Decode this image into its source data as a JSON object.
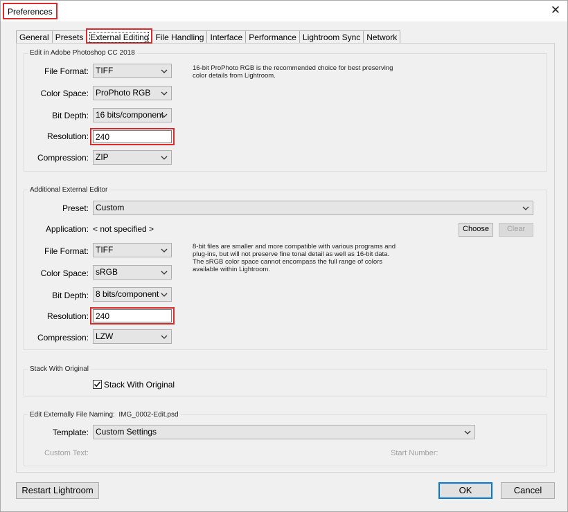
{
  "window": {
    "title": "Preferences",
    "close_symbol": "✕"
  },
  "tabs": [
    "General",
    "Presets",
    "External Editing",
    "File Handling",
    "Interface",
    "Performance",
    "Lightroom Sync",
    "Network"
  ],
  "active_tab": "External Editing",
  "photoshop": {
    "group_label": "Edit in Adobe Photoshop CC 2018",
    "file_format_label": "File Format:",
    "file_format": "TIFF",
    "color_space_label": "Color Space:",
    "color_space": "ProPhoto RGB",
    "bit_depth_label": "Bit Depth:",
    "bit_depth": "16 bits/component",
    "resolution_label": "Resolution:",
    "resolution": "240",
    "compression_label": "Compression:",
    "compression": "ZIP",
    "note": "16-bit ProPhoto RGB is the recommended choice for best preserving\ncolor details from Lightroom."
  },
  "additional": {
    "group_label": "Additional External Editor",
    "preset_label": "Preset:",
    "preset": "Custom",
    "application_label": "Application:",
    "application": "< not specified >",
    "choose_label": "Choose",
    "clear_label": "Clear",
    "file_format_label": "File Format:",
    "file_format": "TIFF",
    "color_space_label": "Color Space:",
    "color_space": "sRGB",
    "bit_depth_label": "Bit Depth:",
    "bit_depth": "8 bits/component",
    "resolution_label": "Resolution:",
    "resolution": "240",
    "compression_label": "Compression:",
    "compression": "LZW",
    "note": "8-bit files are smaller and more compatible with various programs and\nplug-ins, but will not preserve fine tonal detail as well as 16-bit data.\nThe sRGB color space cannot encompass the full range of colors\navailable within Lightroom."
  },
  "stack": {
    "group_label": "Stack With Original",
    "checkbox_label": "Stack With Original",
    "checked": true
  },
  "naming": {
    "group_label": "Edit Externally File Naming:",
    "example": "IMG_0002-Edit.psd",
    "template_label": "Template:",
    "template": "Custom Settings",
    "custom_text_label": "Custom Text:",
    "start_number_label": "Start Number:"
  },
  "footer": {
    "restart_label": "Restart Lightroom",
    "ok_label": "OK",
    "cancel_label": "Cancel"
  },
  "colors": {
    "highlight": "#d92b2b",
    "accent": "#0078d7"
  },
  "icons": {
    "dropdown": "chevron-down-icon",
    "close": "close-icon",
    "check": "check-icon"
  }
}
